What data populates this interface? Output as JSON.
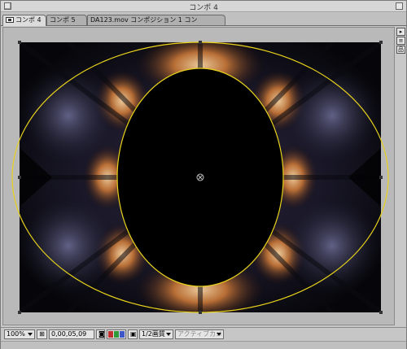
{
  "window": {
    "title": "コンポ 4"
  },
  "tabs": [
    {
      "label": "コンポ 4",
      "active": true
    },
    {
      "label": "コンポ 5",
      "active": false
    },
    {
      "label": "DA123.mov コンポジション 1 コン",
      "active": false
    }
  ],
  "side_buttons": [
    "▸",
    "≡",
    "品"
  ],
  "status": {
    "zoom": "100%",
    "timecode": "0,00,05,09",
    "quality": "1/2画質",
    "camera": "アクティブカメ..."
  },
  "colors": {
    "mask_path": "#e8d21c",
    "image_bg": "#0a0a10",
    "pasteboard": "#b9b9b9",
    "channel_red": "#c03030",
    "channel_green": "#2f9a3a",
    "channel_blue": "#3f56c8"
  },
  "icons": {
    "safe_margins": "safe-zones-icon",
    "camera": "camera-icon",
    "region": "region-of-interest-icon"
  }
}
